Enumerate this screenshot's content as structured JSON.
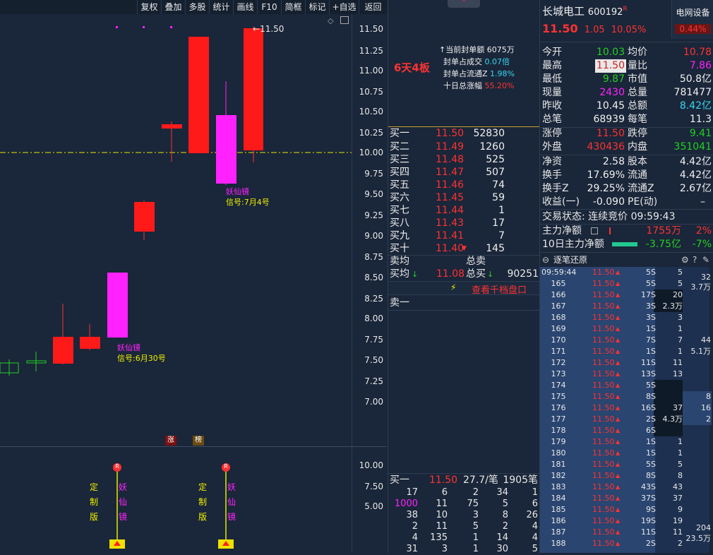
{
  "toolbar": {
    "items": [
      "复权",
      "叠加",
      "多股",
      "统计",
      "画线",
      "F10",
      "简框",
      "标记",
      "+自选",
      "返回"
    ]
  },
  "price_axis": [
    "11.50",
    "11.25",
    "11.00",
    "10.75",
    "10.50",
    "10.25",
    "10.00",
    "9.75",
    "9.50",
    "9.25",
    "9.00",
    "8.75",
    "8.50",
    "8.25",
    "8.00",
    "7.75",
    "7.50",
    "7.25",
    "7.00"
  ],
  "last_price_label": "11.50",
  "signals": [
    {
      "name": "妖仙镜",
      "date": "信号:7月4号"
    },
    {
      "name": "妖仙镜",
      "date": "信号:6月30号"
    }
  ],
  "markers": [
    "涨",
    "榜"
  ],
  "sub_axis": [
    "10.00",
    "7.50",
    "5.00"
  ],
  "sub_labels": {
    "a": [
      "定",
      "制",
      "版"
    ],
    "b": [
      "妖",
      "仙",
      "镜"
    ]
  },
  "r_badge": "R",
  "stock": {
    "name": "长城电工",
    "code": "600192",
    "flag": "R",
    "price": "11.50",
    "change": "1.05",
    "pct": "10.05%",
    "sector": "电网设备",
    "sector_pct": "0.44%"
  },
  "mid_summary": {
    "board": "6天4板",
    "lines": [
      {
        "label": "当前封单额",
        "value": "6075万"
      },
      {
        "label": "封单占成交",
        "value": "0.07倍"
      },
      {
        "label": "封单占流通Z",
        "value": "1.98%"
      },
      {
        "label": "十日总涨幅",
        "value": "55.20%"
      }
    ]
  },
  "bids": [
    {
      "label": "买一",
      "price": "11.50",
      "vol": "52830"
    },
    {
      "label": "买二",
      "price": "11.49",
      "vol": "1260"
    },
    {
      "label": "买三",
      "price": "11.48",
      "vol": "525"
    },
    {
      "label": "买四",
      "price": "11.47",
      "vol": "507"
    },
    {
      "label": "买五",
      "price": "11.46",
      "vol": "74"
    },
    {
      "label": "买六",
      "price": "11.45",
      "vol": "59"
    },
    {
      "label": "买七",
      "price": "11.44",
      "vol": "1"
    },
    {
      "label": "买八",
      "price": "11.43",
      "vol": "17"
    },
    {
      "label": "买九",
      "price": "11.41",
      "vol": "7"
    },
    {
      "label": "买十",
      "price": "11.40",
      "vol": "145"
    }
  ],
  "avg": {
    "sell_avg": "卖均",
    "total_sell": "总卖",
    "buy_avg": "买均",
    "buy_avg_val": "11.08",
    "total_buy": "总买",
    "total_buy_val": "90251"
  },
  "thousand_link": "查看千档盘口",
  "ask1": "卖一",
  "queue": {
    "label": "买一",
    "price": "11.50",
    "per": "27.7/笔",
    "total": "1905笔",
    "rows": [
      [
        "17",
        "6",
        "2",
        "34",
        "1"
      ],
      [
        "1000",
        "11",
        "75",
        "5",
        "6"
      ],
      [
        "38",
        "10",
        "3",
        "8",
        "26"
      ],
      [
        "2",
        "11",
        "5",
        "2",
        "4"
      ],
      [
        "4",
        "135",
        "1",
        "14",
        "4"
      ],
      [
        "31",
        "3",
        "1",
        "30",
        "5"
      ]
    ]
  },
  "quote": [
    {
      "l1": "今开",
      "v1": "10.03",
      "l2": "均价",
      "v2": "10.78"
    },
    {
      "l1": "最高",
      "v1": "11.50",
      "l2": "量比",
      "v2": "7.86"
    },
    {
      "l1": "最低",
      "v1": "9.87",
      "l2": "市值",
      "v2": "50.8亿"
    },
    {
      "l1": "现量",
      "v1": "2430",
      "l2": "总量",
      "v2": "781477"
    },
    {
      "l1": "昨收",
      "v1": "10.45",
      "l2": "总额",
      "v2": "8.42亿"
    },
    {
      "l1": "总笔",
      "v1": "68939",
      "l2": "每笔",
      "v2": "11.3"
    },
    {
      "l1": "涨停",
      "v1": "11.50",
      "l2": "跌停",
      "v2": "9.41"
    },
    {
      "l1": "外盘",
      "v1": "430436",
      "l2": "内盘",
      "v2": "351041"
    },
    {
      "l1": "净资",
      "v1": "2.58",
      "l2": "股本",
      "v2": "4.42亿"
    },
    {
      "l1": "换手",
      "v1": "17.69%",
      "l2": "流通",
      "v2": "4.42亿"
    },
    {
      "l1": "换手Z",
      "v1": "29.25%",
      "l2": "流通Z",
      "v2": "2.67亿"
    },
    {
      "l1": "收益(一)",
      "v1": "-0.090",
      "l2": "PE(动)",
      "v2": "–"
    }
  ],
  "trade_status": "交易状态: 连续竞价 09:59:43",
  "main_flow": {
    "label": "主力净额",
    "value": "1755万",
    "pct": "2%"
  },
  "ten_day_flow": {
    "label": "10日主力净额",
    "value": "-3.75亿",
    "pct": "-7%"
  },
  "tick_title": "逐笔还原",
  "ticks": [
    {
      "t": "09:59:44",
      "p": "11.50",
      "v": "5S",
      "n": "5"
    },
    {
      "t": "165",
      "p": "11.50",
      "v": "5S",
      "n": "5"
    },
    {
      "t": "166",
      "p": "11.50",
      "v": "17S",
      "n": "20"
    },
    {
      "t": "167",
      "p": "11.50",
      "v": "3S",
      "n": "2.3万"
    },
    {
      "t": "168",
      "p": "11.50",
      "v": "3S",
      "n": "3"
    },
    {
      "t": "169",
      "p": "11.50",
      "v": "1S",
      "n": "1"
    },
    {
      "t": "170",
      "p": "11.50",
      "v": "7S",
      "n": "7"
    },
    {
      "t": "171",
      "p": "11.50",
      "v": "1S",
      "n": "1"
    },
    {
      "t": "172",
      "p": "11.50",
      "v": "11S",
      "n": "11"
    },
    {
      "t": "173",
      "p": "11.50",
      "v": "13S",
      "n": "13"
    },
    {
      "t": "174",
      "p": "11.50",
      "v": "5S",
      "n": ""
    },
    {
      "t": "175",
      "p": "11.50",
      "v": "8S",
      "n": ""
    },
    {
      "t": "176",
      "p": "11.50",
      "v": "16S",
      "n": "37"
    },
    {
      "t": "177",
      "p": "11.50",
      "v": "2S",
      "n": "4.3万"
    },
    {
      "t": "178",
      "p": "11.50",
      "v": "6S",
      "n": ""
    },
    {
      "t": "179",
      "p": "11.50",
      "v": "1S",
      "n": "1"
    },
    {
      "t": "180",
      "p": "11.50",
      "v": "1S",
      "n": "1"
    },
    {
      "t": "181",
      "p": "11.50",
      "v": "5S",
      "n": "5"
    },
    {
      "t": "182",
      "p": "11.50",
      "v": "8S",
      "n": "8"
    },
    {
      "t": "183",
      "p": "11.50",
      "v": "43S",
      "n": "43"
    },
    {
      "t": "184",
      "p": "11.50",
      "v": "37S",
      "n": "37"
    },
    {
      "t": "185",
      "p": "11.50",
      "v": "9S",
      "n": "9"
    },
    {
      "t": "186",
      "p": "11.50",
      "v": "19S",
      "n": "19"
    },
    {
      "t": "187",
      "p": "11.50",
      "v": "11S",
      "n": "11"
    },
    {
      "t": "188",
      "p": "11.50",
      "v": "2S",
      "n": "2"
    }
  ],
  "tick_side": [
    {
      "a": "32",
      "b": "3.7万"
    },
    {
      "a": "44",
      "b": "5.1万"
    },
    {
      "a": "8",
      "b": "16",
      "c": "2"
    },
    {
      "a": "204",
      "b": "23.5万"
    }
  ]
}
